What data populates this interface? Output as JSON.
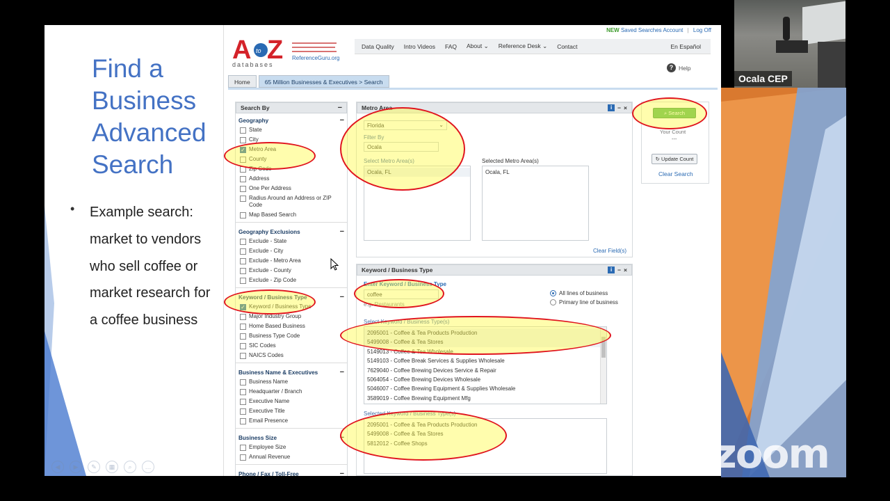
{
  "slide": {
    "title": "Find a Business Advanced Search",
    "bullet": "Example search: market to vendors who sell coffee or market research for a coffee business"
  },
  "site": {
    "topbar": {
      "new_label": "NEW",
      "saved_searches": "Saved Searches Account",
      "separator": "|",
      "logoff": "Log Off"
    },
    "logo": {
      "text": "AtoZ",
      "subtitle": "databases",
      "tagline": "ReferenceGuru.org"
    },
    "nav": [
      "Data Quality",
      "Intro Videos",
      "FAQ",
      "About",
      "Reference Desk",
      "Contact"
    ],
    "language": "En Español",
    "help": "Help",
    "tabs": {
      "home": "Home",
      "search": "65 Million Businesses & Executives > Search"
    }
  },
  "search_by": {
    "header": "Search By",
    "groups": [
      {
        "title": "Geography",
        "items": [
          {
            "label": "State",
            "checked": false
          },
          {
            "label": "City",
            "checked": false
          },
          {
            "label": "Metro Area",
            "checked": true
          },
          {
            "label": "County",
            "checked": false
          },
          {
            "label": "Zip Code",
            "checked": false
          },
          {
            "label": "Address",
            "checked": false
          },
          {
            "label": "One Per Address",
            "checked": false
          },
          {
            "label": "Radius Around an Address or ZIP Code",
            "checked": false
          },
          {
            "label": "Map Based Search",
            "checked": false
          }
        ]
      },
      {
        "title": "Geography Exclusions",
        "items": [
          {
            "label": "Exclude - State",
            "checked": false
          },
          {
            "label": "Exclude - City",
            "checked": false
          },
          {
            "label": "Exclude - Metro Area",
            "checked": false
          },
          {
            "label": "Exclude - County",
            "checked": false
          },
          {
            "label": "Exclude - Zip Code",
            "checked": false
          }
        ]
      },
      {
        "title": "Keyword / Business Type",
        "items": [
          {
            "label": "Keyword / Business Type",
            "checked": true
          },
          {
            "label": "Major Industry Group",
            "checked": false
          },
          {
            "label": "Home Based Business",
            "checked": false
          },
          {
            "label": "Business Type Code",
            "checked": false
          },
          {
            "label": "SIC Codes",
            "checked": false
          },
          {
            "label": "NAICS Codes",
            "checked": false
          }
        ]
      },
      {
        "title": "Business Name & Executives",
        "items": [
          {
            "label": "Business Name",
            "checked": false
          },
          {
            "label": "Headquarter / Branch",
            "checked": false
          },
          {
            "label": "Executive Name",
            "checked": false
          },
          {
            "label": "Executive Title",
            "checked": false
          },
          {
            "label": "Email Presence",
            "checked": false
          }
        ]
      },
      {
        "title": "Business Size",
        "items": [
          {
            "label": "Employee Size",
            "checked": false
          },
          {
            "label": "Annual Revenue",
            "checked": false
          }
        ]
      },
      {
        "title": "Phone / Fax / Toll-Free",
        "items": []
      }
    ]
  },
  "metro": {
    "header": "Metro Area",
    "state_select": "Florida",
    "filter_label": "Filter By",
    "filter_value": "Ocala",
    "select_label": "Select Metro Area(s)",
    "select_items": [
      "Ocala, FL"
    ],
    "selected_label": "Selected Metro Area(s)",
    "selected_items": [
      "Ocala, FL"
    ],
    "clear_fields": "Clear Field(s)"
  },
  "keyword": {
    "header": "Keyword / Business Type",
    "enter_label": "Enter Keyword / Business Type",
    "input_value": "coffee",
    "example": "e.g. Restaurants",
    "radio_all": "All lines of business",
    "radio_primary": "Primary line of business",
    "radio_selected": "all",
    "select_label": "Select Keyword / Business Type(s)",
    "select_items": [
      "2095001 - Coffee & Tea Products Production",
      "5499008 - Coffee & Tea Stores",
      "5149013 - Coffee & Tea Wholesale",
      "5149103 - Coffee Break Services & Supplies Wholesale",
      "7629040 - Coffee Brewing Devices Service & Repair",
      "5064054 - Coffee Brewing Devices Wholesale",
      "5046007 - Coffee Brewing Equipment & Supplies Wholesale",
      "3589019 - Coffee Brewing Equipment Mfg"
    ],
    "selected_label": "Selected Keyword / Business Type(s)",
    "selected_items": [
      "2095001 - Coffee & Tea Products Production",
      "5499008 - Coffee & Tea Stores",
      "5812012 - Coffee Shops"
    ]
  },
  "actions": {
    "search": "Search",
    "your_count": "Your Count",
    "count_value": "---",
    "update_count": "Update Count",
    "clear_search": "Clear Search"
  },
  "webcam": {
    "name": "Ocala CEP"
  },
  "watermark": "zoom",
  "colors": {
    "accent_blue": "#4472c4",
    "annotation_red": "#e0141e",
    "highlight_yellow": "#fffa3c",
    "link_blue": "#2a6ab3"
  }
}
